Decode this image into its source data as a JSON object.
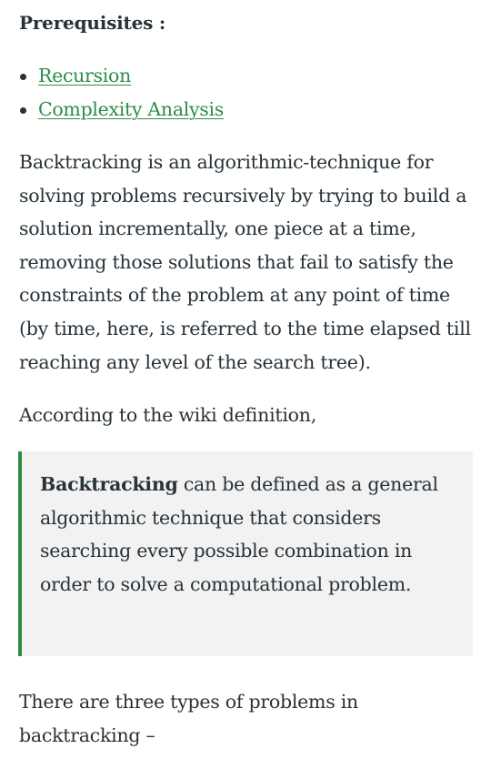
{
  "prerequisites": {
    "heading": "Prerequisites :",
    "links": [
      {
        "label": "Recursion"
      },
      {
        "label": "Complexity Analysis"
      }
    ]
  },
  "intro_paragraph": "Backtracking is an algorithmic-technique for solving problems recursively by trying to build a solution incrementally, one piece at a time, removing those solutions that fail to satisfy the constraints of the problem at any point of time (by time, here, is referred to the time elapsed till reaching any level of the search tree).",
  "wiki_intro": "According to the wiki definition,",
  "blockquote": {
    "bold_term": "Backtracking",
    "text": " can be defined as a general algorithmic technique that considers searching every possible combination in order to solve a computational problem."
  },
  "types_paragraph": "There are three types of problems in backtracking –",
  "colors": {
    "link": "#2f8d46",
    "text": "#273239",
    "quote_background": "#f2f2f2",
    "quote_border": "#2f8d46"
  }
}
